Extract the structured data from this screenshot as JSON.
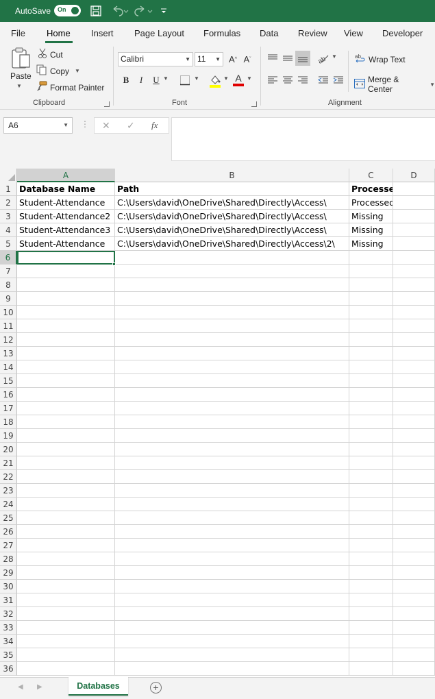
{
  "titlebar": {
    "autosave_label": "AutoSave",
    "autosave_state": "On"
  },
  "ribbon_tabs": [
    "File",
    "Home",
    "Insert",
    "Page Layout",
    "Formulas",
    "Data",
    "Review",
    "View",
    "Developer"
  ],
  "clipboard": {
    "paste": "Paste",
    "cut": "Cut",
    "copy": "Copy",
    "format_painter": "Format Painter",
    "group_label": "Clipboard"
  },
  "font": {
    "family": "Calibri",
    "size": "11",
    "group_label": "Font",
    "bold": "B",
    "italic": "I",
    "underline": "U",
    "font_color_glyph": "A",
    "font_color": "#e00000",
    "highlight_color": "#ffff00"
  },
  "alignment": {
    "wrap_text": "Wrap Text",
    "merge_center": "Merge & Center",
    "group_label": "Alignment"
  },
  "formula_bar": {
    "name_box": "A6",
    "fx": "fx",
    "content": ""
  },
  "columns": [
    "A",
    "B",
    "C",
    "D"
  ],
  "cells": [
    {
      "a": "Database Name",
      "b": "Path",
      "c": "Processed"
    },
    {
      "a": "Student-Attendance",
      "b": "C:\\Users\\david\\OneDrive\\Shared\\Directly\\Access\\",
      "c": "Processed"
    },
    {
      "a": "Student-Attendance2",
      "b": "C:\\Users\\david\\OneDrive\\Shared\\Directly\\Access\\",
      "c": "Missing"
    },
    {
      "a": "Student-Attendance3",
      "b": "C:\\Users\\david\\OneDrive\\Shared\\Directly\\Access\\",
      "c": "Missing"
    },
    {
      "a": "Student-Attendance",
      "b": "C:\\Users\\david\\OneDrive\\Shared\\Directly\\Access\\2\\",
      "c": "Missing"
    }
  ],
  "row_count": 36,
  "sheet_tab": "Databases",
  "colors": {
    "brand": "#217346"
  }
}
